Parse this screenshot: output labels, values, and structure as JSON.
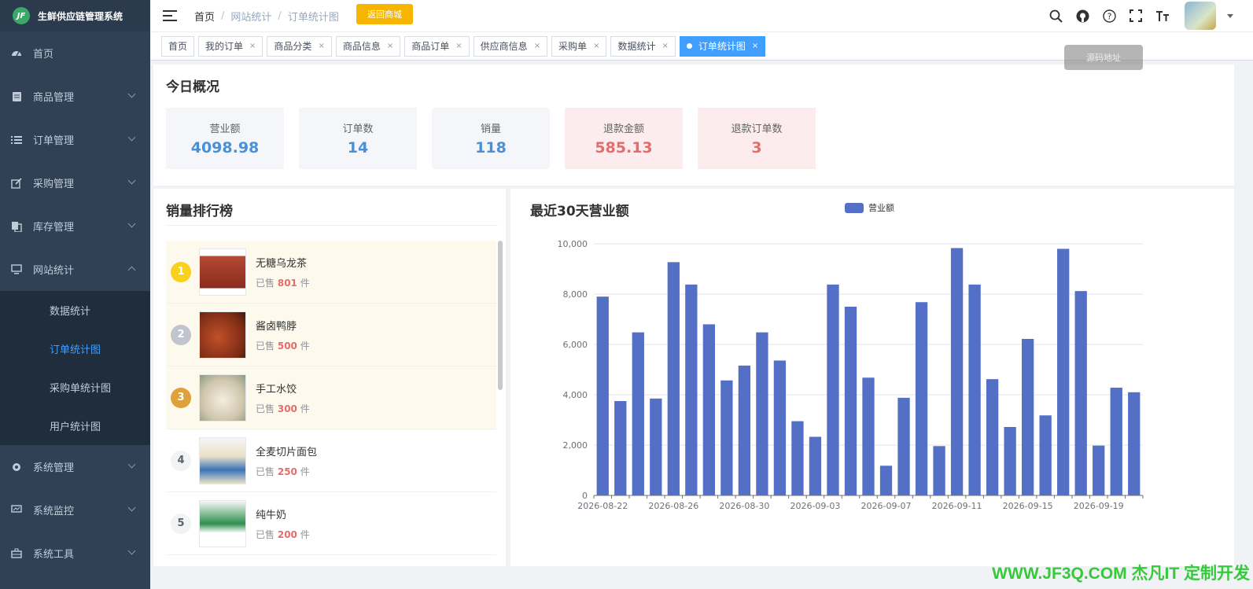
{
  "app": {
    "logo_text": "JF",
    "title": "生鲜供应链管理系统"
  },
  "sidebar": {
    "items": [
      {
        "label": "首页",
        "icon": "dashboard-icon"
      },
      {
        "label": "商品管理",
        "icon": "document-icon"
      },
      {
        "label": "订单管理",
        "icon": "list-icon"
      },
      {
        "label": "采购管理",
        "icon": "edit-icon"
      },
      {
        "label": "库存管理",
        "icon": "copy-icon"
      },
      {
        "label": "网站统计",
        "icon": "monitor-icon"
      }
    ],
    "submenu": [
      {
        "label": "数据统计"
      },
      {
        "label": "订单统计图"
      },
      {
        "label": "采购单统计图"
      },
      {
        "label": "用户统计图"
      }
    ],
    "items_after": [
      {
        "label": "系统管理",
        "icon": "gear-icon"
      },
      {
        "label": "系统监控",
        "icon": "monitor-chart-icon"
      },
      {
        "label": "系统工具",
        "icon": "toolbox-icon"
      }
    ]
  },
  "navbar": {
    "breadcrumb": [
      "首页",
      "网站统计",
      "订单统计图"
    ],
    "shop_button": "返回商城",
    "tooltip": "源码地址"
  },
  "tags": [
    {
      "label": "首页"
    },
    {
      "label": "我的订单"
    },
    {
      "label": "商品分类"
    },
    {
      "label": "商品信息"
    },
    {
      "label": "商品订单"
    },
    {
      "label": "供应商信息"
    },
    {
      "label": "采购单"
    },
    {
      "label": "数据统计"
    },
    {
      "label": "订单统计图"
    }
  ],
  "overview": {
    "title": "今日概况",
    "stats": [
      {
        "label": "营业额",
        "value": "4098.98"
      },
      {
        "label": "订单数",
        "value": "14"
      },
      {
        "label": "销量",
        "value": "118"
      },
      {
        "label": "退款金额",
        "value": "585.13"
      },
      {
        "label": "退款订单数",
        "value": "3"
      }
    ]
  },
  "ranking": {
    "title": "销量排行榜",
    "sold_prefix": "已售",
    "sold_suffix": "件",
    "items": [
      {
        "rank": "1",
        "name": "无糖乌龙茶",
        "sold": "801"
      },
      {
        "rank": "2",
        "name": "酱卤鸭脖",
        "sold": "500"
      },
      {
        "rank": "3",
        "name": "手工水饺",
        "sold": "300"
      },
      {
        "rank": "4",
        "name": "全麦切片面包",
        "sold": "250"
      },
      {
        "rank": "5",
        "name": "纯牛奶",
        "sold": "200"
      }
    ]
  },
  "footer": {
    "watermark": "WWW.JF3Q.COM 杰凡IT 定制开发"
  },
  "colors": {
    "sidebar_bg": "#304156",
    "accent": "#409eff",
    "bar": "#5470c6",
    "refund": "#e26d6d"
  },
  "chart_data": {
    "type": "bar",
    "title": "最近30天营业额",
    "series": [
      {
        "name": "营业额",
        "values": [
          7900,
          3750,
          6480,
          3850,
          9270,
          8380,
          6800,
          4570,
          5160,
          6480,
          5360,
          2950,
          2330,
          8380,
          7500,
          4680,
          1180,
          3880,
          7680,
          1960,
          9830,
          8380,
          4620,
          2720,
          6220,
          3180,
          9800,
          8120,
          1980,
          4280,
          4100
        ]
      }
    ],
    "categories": [
      "2026-08-22",
      "2026-08-23",
      "2026-08-24",
      "2026-08-25",
      "2026-08-26",
      "2026-08-27",
      "2026-08-28",
      "2026-08-29",
      "2026-08-30",
      "2026-08-31",
      "2026-09-01",
      "2026-09-02",
      "2026-09-03",
      "2026-09-04",
      "2026-09-05",
      "2026-09-06",
      "2026-09-07",
      "2026-09-08",
      "2026-09-09",
      "2026-09-10",
      "2026-09-11",
      "2026-09-12",
      "2026-09-13",
      "2026-09-14",
      "2026-09-15",
      "2026-09-16",
      "2026-09-17",
      "2026-09-18",
      "2026-09-19",
      "2026-09-20",
      "2026-09-21"
    ],
    "x_tick_labels": [
      "2026-08-22",
      "2026-08-26",
      "2026-08-30",
      "2026-09-03",
      "2026-09-07",
      "2026-09-11",
      "2026-09-15",
      "2026-09-19"
    ],
    "y_tick_labels": [
      "0",
      "2,000",
      "4,000",
      "6,000",
      "8,000",
      "10,000"
    ],
    "ylim": [
      0,
      10000
    ],
    "grid": true,
    "legend_position": "top-center"
  }
}
